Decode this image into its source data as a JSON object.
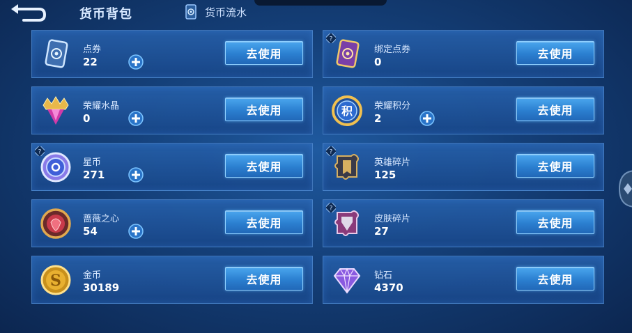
{
  "header": {
    "title": "货币背包",
    "flow_tab_label": "货币流水"
  },
  "use_label": "去使用",
  "currencies": [
    {
      "name": "点券",
      "value": "22",
      "icon": "ticket-card-icon",
      "has_plus": true,
      "has_help": false
    },
    {
      "name": "绑定点券",
      "value": "0",
      "icon": "bound-ticket-card-icon",
      "has_plus": false,
      "has_help": true
    },
    {
      "name": "荣耀水晶",
      "value": "0",
      "icon": "glory-crystal-icon",
      "has_plus": true,
      "has_help": false
    },
    {
      "name": "荣耀积分",
      "value": "2",
      "icon": "glory-points-icon",
      "has_plus": true,
      "has_help": false
    },
    {
      "name": "星币",
      "value": "271",
      "icon": "star-coin-icon",
      "has_plus": true,
      "has_help": true
    },
    {
      "name": "英雄碎片",
      "value": "125",
      "icon": "hero-fragment-icon",
      "has_plus": false,
      "has_help": true
    },
    {
      "name": "蔷薇之心",
      "value": "54",
      "icon": "rose-heart-icon",
      "has_plus": true,
      "has_help": false
    },
    {
      "name": "皮肤碎片",
      "value": "27",
      "icon": "skin-fragment-icon",
      "has_plus": false,
      "has_help": true
    },
    {
      "name": "金币",
      "value": "30189",
      "icon": "gold-coin-icon",
      "has_plus": false,
      "has_help": false
    },
    {
      "name": "钻石",
      "value": "4370",
      "icon": "diamond-icon",
      "has_plus": false,
      "has_help": false
    }
  ],
  "colors": {
    "button_blue": "#2b7fd0",
    "card_blue": "#1f5a9c",
    "background": "#143f78"
  }
}
